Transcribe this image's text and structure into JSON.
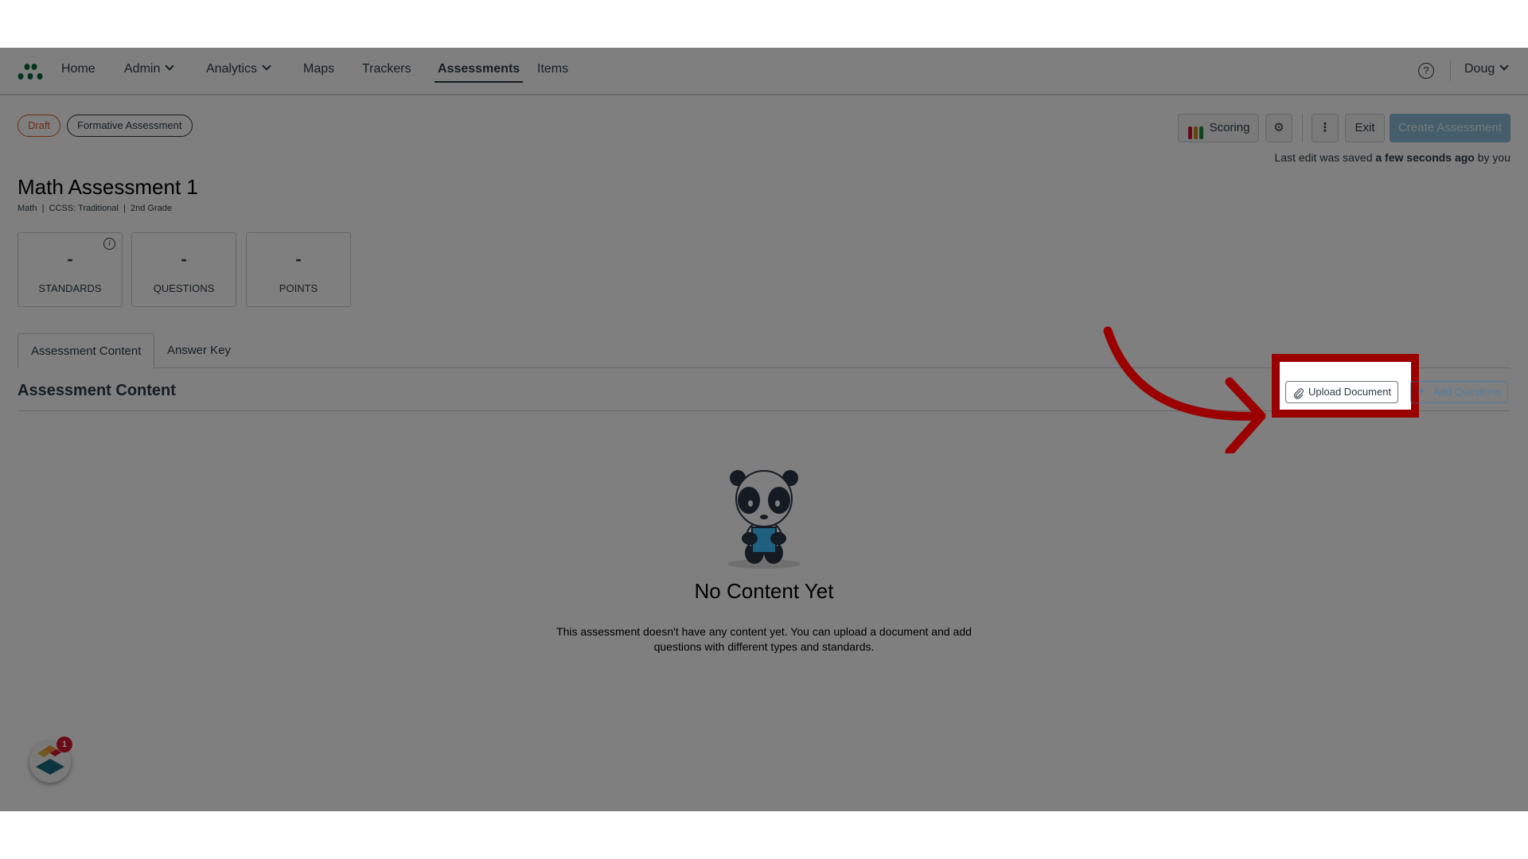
{
  "nav": {
    "items": [
      {
        "label": "Home",
        "has_dropdown": false,
        "active": false
      },
      {
        "label": "Admin",
        "has_dropdown": true,
        "active": false
      },
      {
        "label": "Analytics",
        "has_dropdown": true,
        "active": false
      },
      {
        "label": "Maps",
        "has_dropdown": false,
        "active": false
      },
      {
        "label": "Trackers",
        "has_dropdown": false,
        "active": false
      },
      {
        "label": "Assessments",
        "has_dropdown": false,
        "active": true
      },
      {
        "label": "Items",
        "has_dropdown": false,
        "active": false
      }
    ],
    "help_icon": "question-circle-icon",
    "help_glyph": "?",
    "user": "Doug"
  },
  "tags": {
    "status": "Draft",
    "type": "Formative Assessment"
  },
  "toolbar": {
    "scoring_label": "Scoring",
    "settings_icon": "gear-icon",
    "settings_glyph": "⚙",
    "more_glyph": "⋮",
    "exit_label": "Exit",
    "create_label": "Create Assessment",
    "saved_prefix": "Last edit was saved ",
    "saved_time": "a few seconds ago",
    "saved_suffix": " by you"
  },
  "assessment": {
    "title": "Math Assessment 1",
    "meta": "Math  |  CCSS: Traditional  |  2nd Grade"
  },
  "stats": [
    {
      "value": "-",
      "label": "STANDARDS",
      "info": "i"
    },
    {
      "value": "-",
      "label": "QUESTIONS"
    },
    {
      "value": "-",
      "label": "POINTS"
    }
  ],
  "tabs": [
    {
      "label": "Assessment Content",
      "active": true
    },
    {
      "label": "Answer Key",
      "active": false
    }
  ],
  "content": {
    "section_title": "Assessment Content",
    "upload_label": "Upload Document",
    "upload_glyph": "📎",
    "add_label": "Add Questions",
    "add_glyph": "+",
    "empty_title": "No Content Yet",
    "empty_text": "This assessment doesn't have any content yet. You can upload a document and add questions with different types and standards."
  },
  "widget": {
    "badge_count": "1"
  },
  "colors": {
    "accent": "#2b7abc",
    "draft": "#e0582a",
    "create_button": "#88bcd6",
    "highlight": "#9b0000",
    "logo_green": "#0b6b3a"
  }
}
